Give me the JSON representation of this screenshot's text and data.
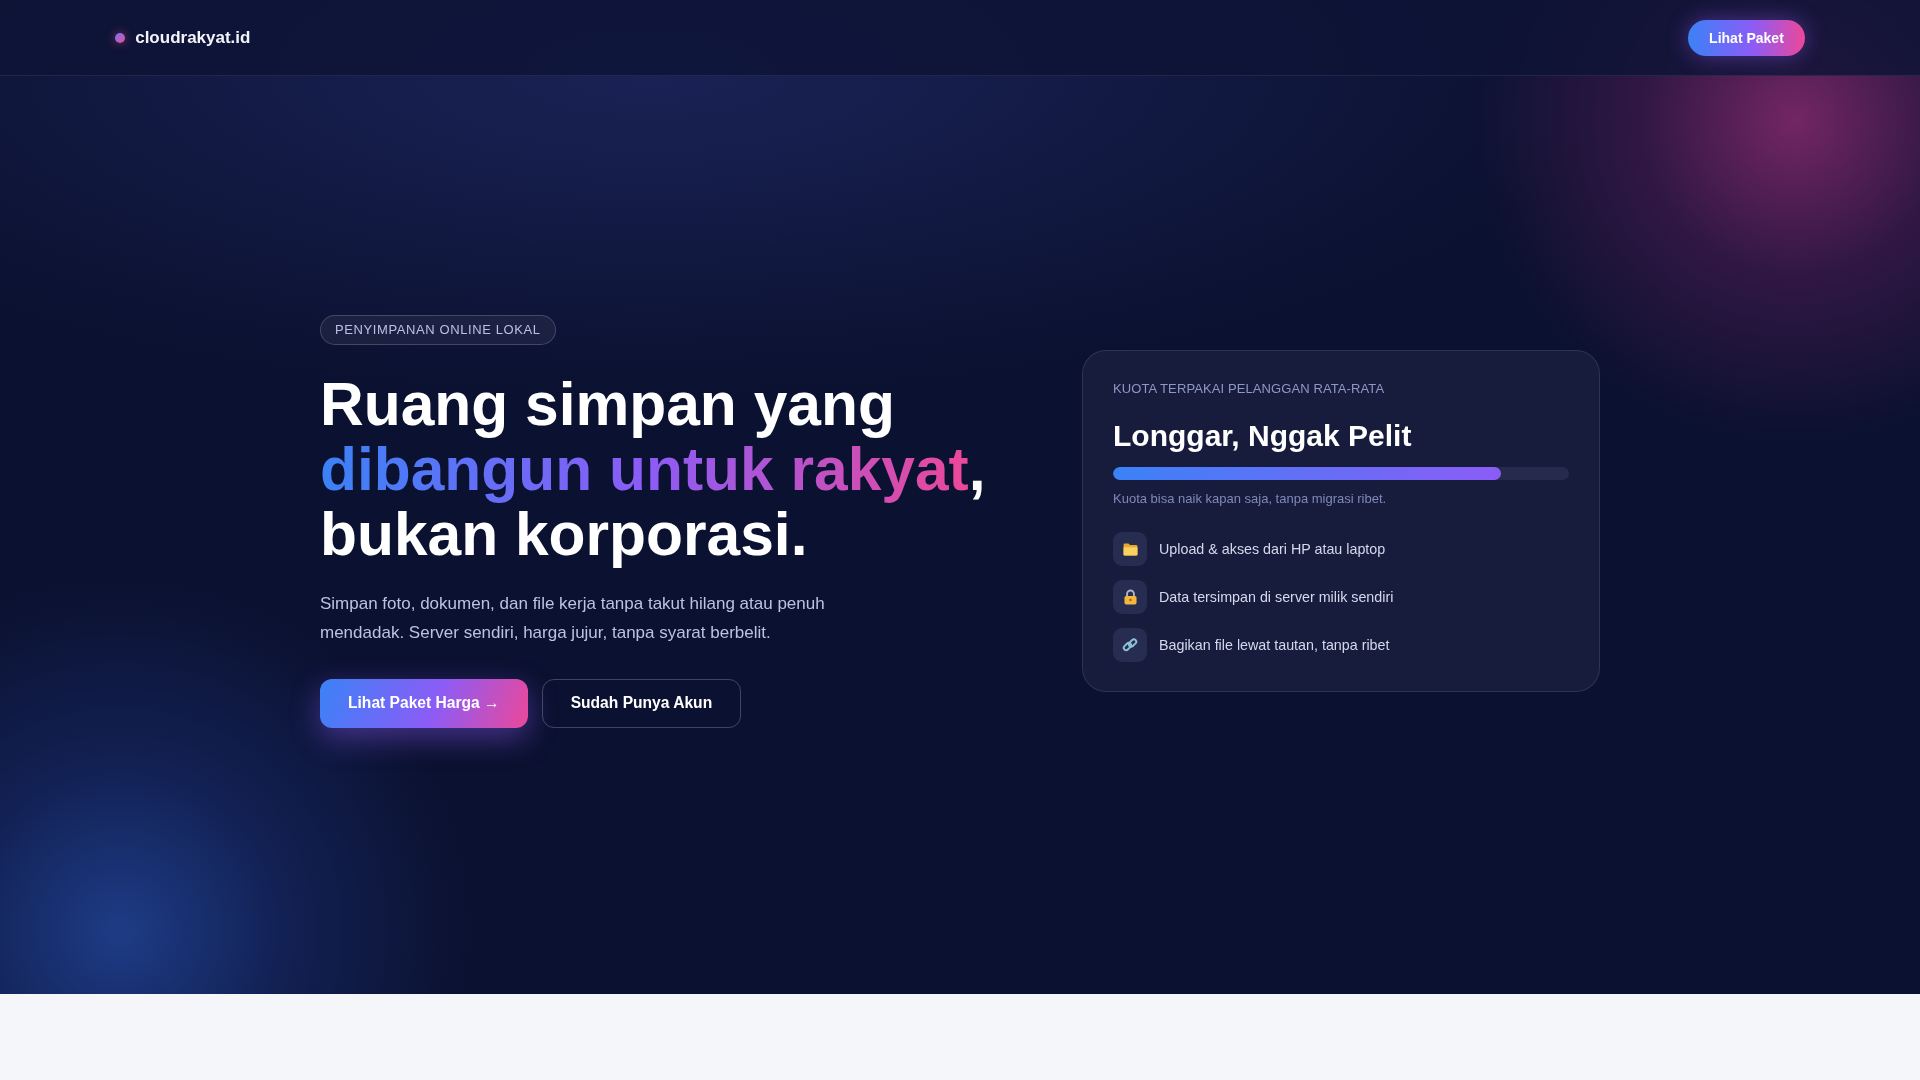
{
  "header": {
    "brand": "cloudrakyat.id",
    "button": "Lihat Paket"
  },
  "hero": {
    "badge": "PENYIMPANAN ONLINE LOKAL",
    "heading": {
      "line_1": "Ruang simpan yang",
      "highlight": "dibangun untuk rakyat",
      "line_2_end": ",",
      "line_3": "bukan korporasi."
    },
    "description": "Simpan foto, dokumen, dan file kerja tanpa takut hilang atau penuh mendadak. Server sendiri, harga jujur, tanpa syarat berbelit.",
    "buttons": [
      {
        "label": "Lihat Paket Harga →",
        "kind": "primary"
      },
      {
        "label": "Sudah Punya Akun",
        "kind": "secondary"
      }
    ]
  },
  "quota_card": {
    "eyebrow": "KUOTA TERPAKAI PELANGGAN RATA-RATA",
    "title": "Longgar, Nggak Pelit",
    "progress": {
      "level": 0.85
    },
    "note": "Kuota bisa naik kapan saja, tanpa migrasi ribet.",
    "features": [
      "Upload & akses dari HP atau laptop",
      "Data tersimpan di server milik sendiri",
      "Bagikan file lewat tautan, tanpa ribet"
    ]
  }
}
